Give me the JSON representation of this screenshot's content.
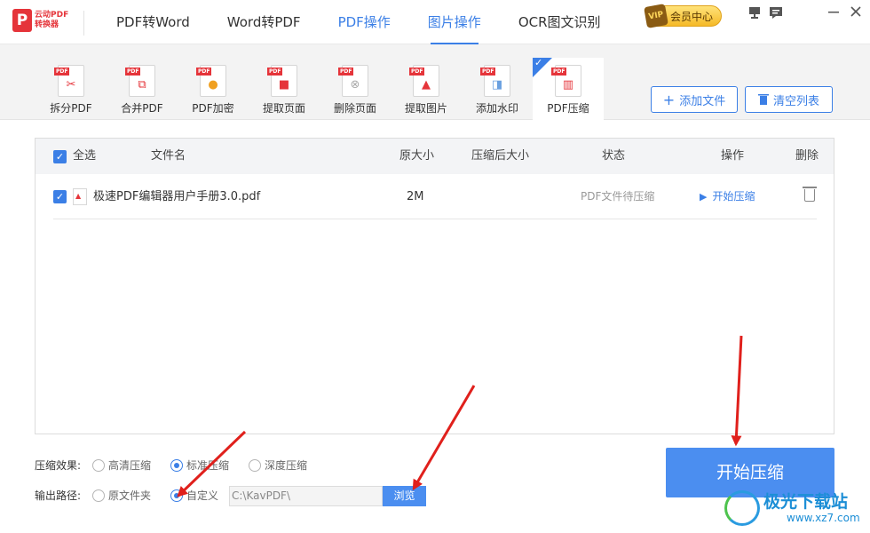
{
  "app": {
    "logo_mark": "P",
    "logo_line1": "云动PDF",
    "logo_line2": "转换器"
  },
  "nav": {
    "items": [
      {
        "label": "PDF转Word"
      },
      {
        "label": "Word转PDF"
      },
      {
        "label": "PDF操作"
      },
      {
        "label": "图片操作"
      },
      {
        "label": "OCR图文识别"
      }
    ],
    "vip_badge": "VIP",
    "vip_label": "会员中心",
    "window_icons": [
      "pin-icon",
      "message-icon",
      "minimize-icon",
      "close-icon"
    ]
  },
  "toolbar": {
    "tools": [
      {
        "label": "拆分PDF",
        "icon": "split-pdf-icon"
      },
      {
        "label": "合并PDF",
        "icon": "merge-pdf-icon"
      },
      {
        "label": "PDF加密",
        "icon": "encrypt-pdf-icon"
      },
      {
        "label": "提取页面",
        "icon": "extract-pages-icon"
      },
      {
        "label": "删除页面",
        "icon": "delete-pages-icon"
      },
      {
        "label": "提取图片",
        "icon": "extract-images-icon"
      },
      {
        "label": "添加水印",
        "icon": "add-watermark-icon"
      },
      {
        "label": "PDF压缩",
        "icon": "compress-pdf-icon"
      }
    ],
    "pdf_tag": "PDF",
    "add_file": "添加文件",
    "clear_list": "清空列表"
  },
  "table": {
    "headers": {
      "select_all": "全选",
      "filename": "文件名",
      "original_size": "原大小",
      "compressed_size": "压缩后大小",
      "status": "状态",
      "action": "操作",
      "delete": "删除"
    },
    "rows": [
      {
        "checked": true,
        "filename": "极速PDF编辑器用户手册3.0.pdf",
        "original_size": "2M",
        "compressed_size": "",
        "status": "PDF文件待压缩",
        "action": "开始压缩"
      }
    ]
  },
  "options": {
    "compress_label": "压缩效果:",
    "compress_choices": [
      "高清压缩",
      "标准压缩",
      "深度压缩"
    ],
    "compress_selected": "标准压缩",
    "output_label": "输出路径:",
    "output_choices": [
      "原文件夹",
      "自定义"
    ],
    "output_selected": "自定义",
    "path_value": "C:\\KavPDF\\",
    "browse": "浏览"
  },
  "start_button": "开始压缩",
  "watermark": {
    "name": "极光下载站",
    "url": "www.xz7.com"
  },
  "colors": {
    "accent": "#3b7fe6",
    "brand_red": "#e5343a",
    "annotation_arrow": "#e0201c"
  }
}
